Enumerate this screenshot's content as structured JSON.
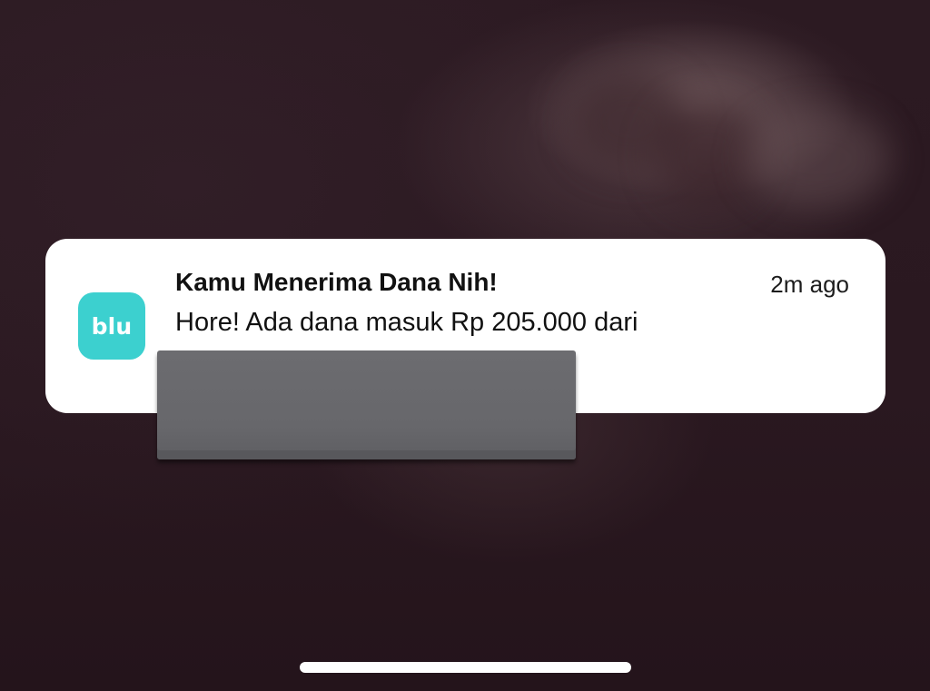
{
  "notification": {
    "app_icon_text": "blu",
    "title": "Kamu Menerima Dana Nih!",
    "time": "2m ago",
    "body": "Hore! Ada dana masuk Rp 205.000 dari"
  },
  "colors": {
    "app_icon_bg": "#3cd0cf",
    "card_bg": "#ffffff",
    "redaction": "#68686c",
    "wallpaper": "#2a1820"
  },
  "icons": {
    "app_icon": "blu-app-icon"
  }
}
